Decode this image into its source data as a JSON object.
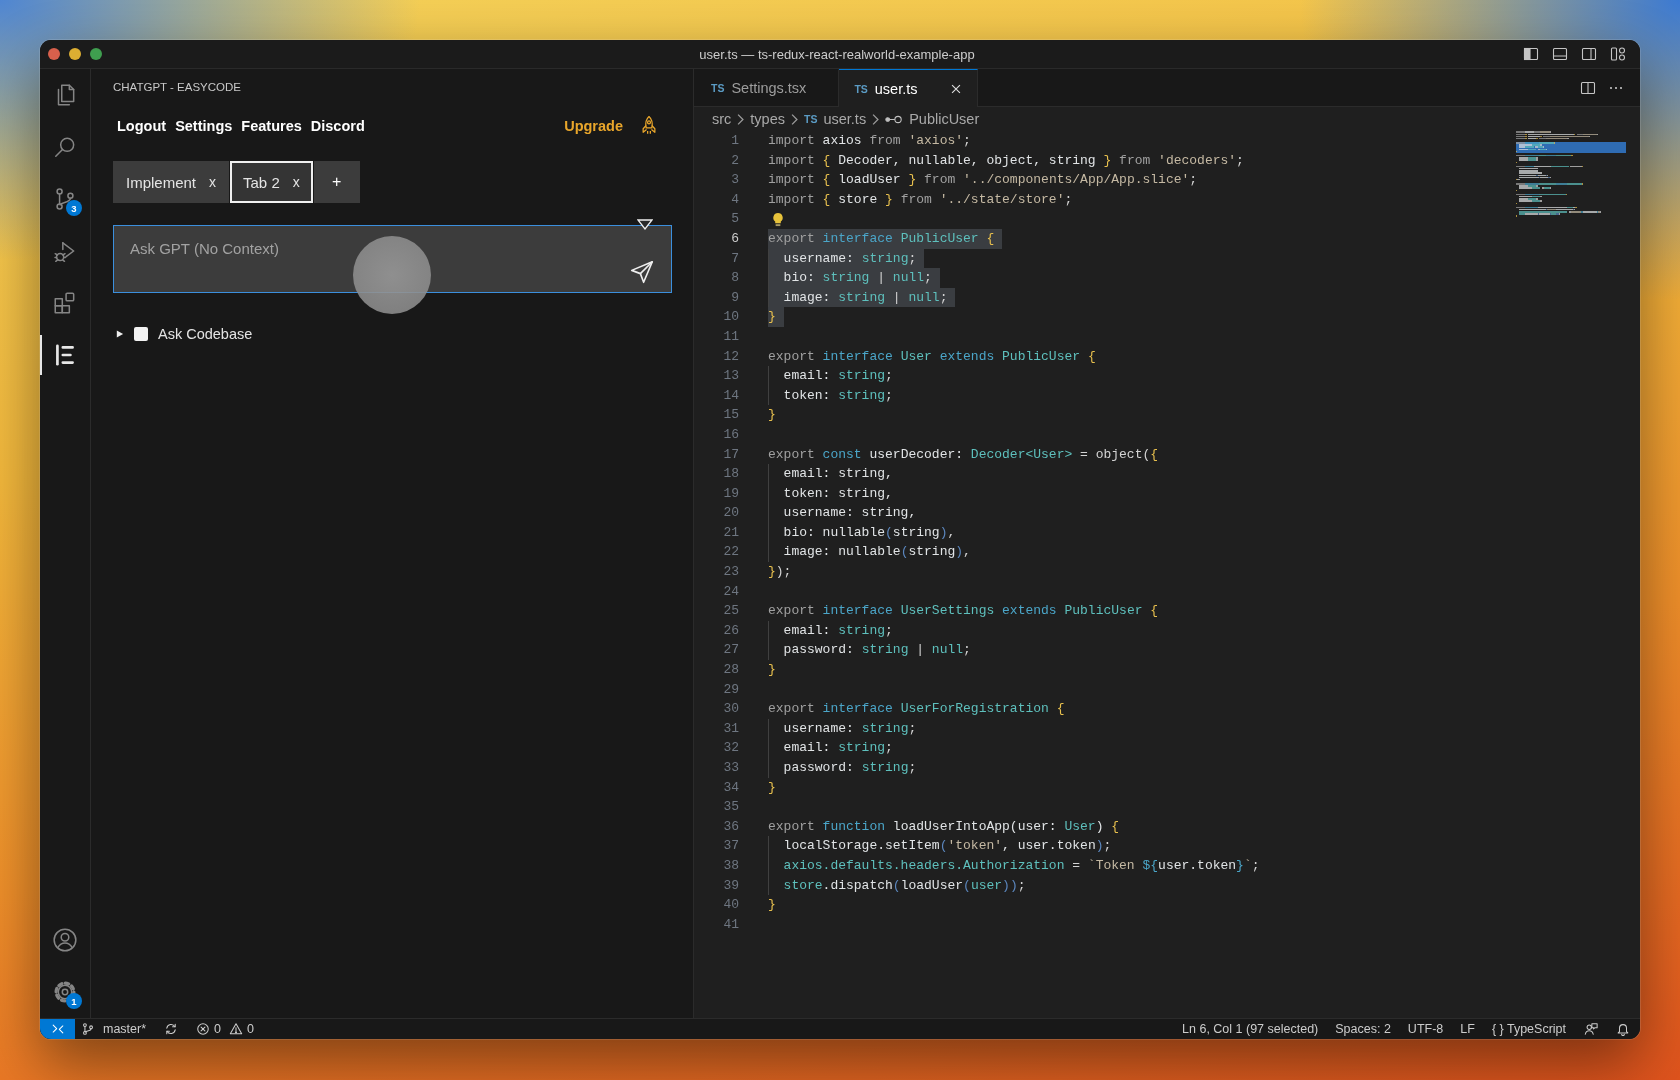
{
  "window": {
    "title": "user.ts — ts-redux-react-realworld-example-app"
  },
  "activity_bar": {
    "items": [
      {
        "selected": false
      },
      {
        "selected": false
      },
      {
        "selected": false,
        "badge": "3"
      },
      {
        "selected": false
      },
      {
        "selected": false
      },
      {
        "selected": true
      }
    ],
    "manage_badge": "1"
  },
  "sidebar": {
    "title": "CHATGPT - EASYCODE",
    "links": [
      "Logout",
      "Settings",
      "Features",
      "Discord"
    ],
    "upgrade": "Upgrade",
    "tabs": [
      {
        "label": "Implement",
        "close": "x",
        "selected": false
      },
      {
        "label": "Tab 2",
        "close": "x",
        "selected": true
      }
    ],
    "new_tab": "+",
    "prompt": {
      "placeholder": "Ask GPT (No Context)"
    },
    "ask_codebase": {
      "label": "Ask Codebase",
      "expanded": false,
      "checked": false
    }
  },
  "editor": {
    "tabs": [
      {
        "file_badge": "TS",
        "label": "Settings.tsx",
        "selected": false
      },
      {
        "file_badge": "TS",
        "label": "user.ts",
        "selected": true
      }
    ],
    "breadcrumbs": [
      {
        "kind": "folder",
        "label": "src"
      },
      {
        "kind": "folder",
        "label": "types"
      },
      {
        "kind": "file",
        "badge": "TS",
        "label": "user.ts"
      },
      {
        "kind": "symbol",
        "label": "PublicUser"
      }
    ],
    "lines": [
      {
        "n": "1",
        "selected": false,
        "current": false,
        "lightbulb": false,
        "tokens": [
          {
            "kind": "keyword",
            "text": "import "
          },
          {
            "kind": "name",
            "text": "axios "
          },
          {
            "kind": "keyword",
            "text": "from "
          },
          {
            "kind": "string",
            "text": "'axios'"
          },
          {
            "kind": "punct",
            "text": ";"
          }
        ]
      },
      {
        "n": "2",
        "selected": false,
        "current": false,
        "lightbulb": false,
        "tokens": [
          {
            "kind": "keyword",
            "text": "import "
          },
          {
            "kind": "brace",
            "text": "{"
          },
          {
            "kind": "name",
            "text": " Decoder, nullable, object, string "
          },
          {
            "kind": "brace",
            "text": "}"
          },
          {
            "kind": "keyword",
            "text": " from "
          },
          {
            "kind": "string",
            "text": "'decoders'"
          },
          {
            "kind": "punct",
            "text": ";"
          }
        ]
      },
      {
        "n": "3",
        "selected": false,
        "current": false,
        "lightbulb": false,
        "tokens": [
          {
            "kind": "keyword",
            "text": "import "
          },
          {
            "kind": "brace",
            "text": "{"
          },
          {
            "kind": "name",
            "text": " loadUser "
          },
          {
            "kind": "brace",
            "text": "}"
          },
          {
            "kind": "keyword",
            "text": " from "
          },
          {
            "kind": "string",
            "text": "'../components/App/App.slice'"
          },
          {
            "kind": "punct",
            "text": ";"
          }
        ]
      },
      {
        "n": "4",
        "selected": false,
        "current": false,
        "lightbulb": false,
        "tokens": [
          {
            "kind": "keyword",
            "text": "import "
          },
          {
            "kind": "brace",
            "text": "{"
          },
          {
            "kind": "name",
            "text": " store "
          },
          {
            "kind": "brace",
            "text": "}"
          },
          {
            "kind": "keyword",
            "text": " from "
          },
          {
            "kind": "string",
            "text": "'../state/store'"
          },
          {
            "kind": "punct",
            "text": ";"
          }
        ]
      },
      {
        "n": "5",
        "selected": false,
        "current": false,
        "lightbulb": true
      },
      {
        "n": "6",
        "selected": true,
        "current": true,
        "lightbulb": false,
        "tokens": [
          {
            "kind": "keyword",
            "text": "export "
          },
          {
            "kind": "storage",
            "text": "interface "
          },
          {
            "kind": "type",
            "text": "PublicUser "
          },
          {
            "kind": "brace",
            "text": "{"
          }
        ]
      },
      {
        "n": "7",
        "selected": true,
        "current": false,
        "lightbulb": false,
        "tokens": [
          {
            "kind": "name",
            "text": "  username: "
          },
          {
            "kind": "type",
            "text": "string"
          },
          {
            "kind": "punct",
            "text": ";"
          }
        ]
      },
      {
        "n": "8",
        "selected": true,
        "current": false,
        "lightbulb": false,
        "tokens": [
          {
            "kind": "name",
            "text": "  bio: "
          },
          {
            "kind": "type",
            "text": "string"
          },
          {
            "kind": "punct",
            "text": " | "
          },
          {
            "kind": "type",
            "text": "null"
          },
          {
            "kind": "punct",
            "text": ";"
          }
        ]
      },
      {
        "n": "9",
        "selected": true,
        "current": false,
        "lightbulb": false,
        "tokens": [
          {
            "kind": "name",
            "text": "  image: "
          },
          {
            "kind": "type",
            "text": "string"
          },
          {
            "kind": "punct",
            "text": " | "
          },
          {
            "kind": "type",
            "text": "null"
          },
          {
            "kind": "punct",
            "text": ";"
          }
        ]
      },
      {
        "n": "10",
        "selected": true,
        "current": false,
        "lightbulb": false,
        "tokens": [
          {
            "kind": "brace",
            "text": "}"
          }
        ]
      },
      {
        "n": "11",
        "selected": false,
        "current": false,
        "lightbulb": false
      },
      {
        "n": "12",
        "selected": false,
        "current": false,
        "lightbulb": false,
        "tokens": [
          {
            "kind": "keyword",
            "text": "export "
          },
          {
            "kind": "storage",
            "text": "interface "
          },
          {
            "kind": "type",
            "text": "User "
          },
          {
            "kind": "storage",
            "text": "extends "
          },
          {
            "kind": "type",
            "text": "PublicUser "
          },
          {
            "kind": "brace",
            "text": "{"
          }
        ]
      },
      {
        "n": "13",
        "selected": false,
        "current": false,
        "lightbulb": false,
        "tokens": [
          {
            "kind": "name",
            "text": "  email: "
          },
          {
            "kind": "type",
            "text": "string"
          },
          {
            "kind": "punct",
            "text": ";"
          }
        ]
      },
      {
        "n": "14",
        "selected": false,
        "current": false,
        "lightbulb": false,
        "tokens": [
          {
            "kind": "name",
            "text": "  token: "
          },
          {
            "kind": "type",
            "text": "string"
          },
          {
            "kind": "punct",
            "text": ";"
          }
        ]
      },
      {
        "n": "15",
        "selected": false,
        "current": false,
        "lightbulb": false,
        "tokens": [
          {
            "kind": "brace",
            "text": "}"
          }
        ]
      },
      {
        "n": "16",
        "selected": false,
        "current": false,
        "lightbulb": false
      },
      {
        "n": "17",
        "selected": false,
        "current": false,
        "lightbulb": false,
        "tokens": [
          {
            "kind": "keyword",
            "text": "export "
          },
          {
            "kind": "storage",
            "text": "const "
          },
          {
            "kind": "name",
            "text": "userDecoder: "
          },
          {
            "kind": "type",
            "text": "Decoder<User>"
          },
          {
            "kind": "punct",
            "text": " = object("
          },
          {
            "kind": "brace",
            "text": "{"
          }
        ]
      },
      {
        "n": "18",
        "selected": false,
        "current": false,
        "lightbulb": false,
        "tokens": [
          {
            "kind": "name",
            "text": "  email: string,"
          }
        ]
      },
      {
        "n": "19",
        "selected": false,
        "current": false,
        "lightbulb": false,
        "tokens": [
          {
            "kind": "name",
            "text": "  token: string,"
          }
        ]
      },
      {
        "n": "20",
        "selected": false,
        "current": false,
        "lightbulb": false,
        "tokens": [
          {
            "kind": "name",
            "text": "  username: string,"
          }
        ]
      },
      {
        "n": "21",
        "selected": false,
        "current": false,
        "lightbulb": false,
        "tokens": [
          {
            "kind": "name",
            "text": "  bio: nullable"
          },
          {
            "kind": "paren",
            "text": "("
          },
          {
            "kind": "name",
            "text": "string"
          },
          {
            "kind": "paren",
            "text": ")"
          },
          {
            "kind": "punct",
            "text": ","
          }
        ]
      },
      {
        "n": "22",
        "selected": false,
        "current": false,
        "lightbulb": false,
        "tokens": [
          {
            "kind": "name",
            "text": "  image: nullable"
          },
          {
            "kind": "paren",
            "text": "("
          },
          {
            "kind": "name",
            "text": "string"
          },
          {
            "kind": "paren",
            "text": ")"
          },
          {
            "kind": "punct",
            "text": ","
          }
        ]
      },
      {
        "n": "23",
        "selected": false,
        "current": false,
        "lightbulb": false,
        "tokens": [
          {
            "kind": "brace",
            "text": "}"
          },
          {
            "kind": "punct",
            "text": ");"
          }
        ]
      },
      {
        "n": "24",
        "selected": false,
        "current": false,
        "lightbulb": false
      },
      {
        "n": "25",
        "selected": false,
        "current": false,
        "lightbulb": false,
        "tokens": [
          {
            "kind": "keyword",
            "text": "export "
          },
          {
            "kind": "storage",
            "text": "interface "
          },
          {
            "kind": "type",
            "text": "UserSettings "
          },
          {
            "kind": "storage",
            "text": "extends "
          },
          {
            "kind": "type",
            "text": "PublicUser "
          },
          {
            "kind": "brace",
            "text": "{"
          }
        ]
      },
      {
        "n": "26",
        "selected": false,
        "current": false,
        "lightbulb": false,
        "tokens": [
          {
            "kind": "name",
            "text": "  email: "
          },
          {
            "kind": "type",
            "text": "string"
          },
          {
            "kind": "punct",
            "text": ";"
          }
        ]
      },
      {
        "n": "27",
        "selected": false,
        "current": false,
        "lightbulb": false,
        "tokens": [
          {
            "kind": "name",
            "text": "  password: "
          },
          {
            "kind": "type",
            "text": "string"
          },
          {
            "kind": "punct",
            "text": " | "
          },
          {
            "kind": "type",
            "text": "null"
          },
          {
            "kind": "punct",
            "text": ";"
          }
        ]
      },
      {
        "n": "28",
        "selected": false,
        "current": false,
        "lightbulb": false,
        "tokens": [
          {
            "kind": "brace",
            "text": "}"
          }
        ]
      },
      {
        "n": "29",
        "selected": false,
        "current": false,
        "lightbulb": false
      },
      {
        "n": "30",
        "selected": false,
        "current": false,
        "lightbulb": false,
        "tokens": [
          {
            "kind": "keyword",
            "text": "export "
          },
          {
            "kind": "storage",
            "text": "interface "
          },
          {
            "kind": "type",
            "text": "UserForRegistration "
          },
          {
            "kind": "brace",
            "text": "{"
          }
        ]
      },
      {
        "n": "31",
        "selected": false,
        "current": false,
        "lightbulb": false,
        "tokens": [
          {
            "kind": "name",
            "text": "  username: "
          },
          {
            "kind": "type",
            "text": "string"
          },
          {
            "kind": "punct",
            "text": ";"
          }
        ]
      },
      {
        "n": "32",
        "selected": false,
        "current": false,
        "lightbulb": false,
        "tokens": [
          {
            "kind": "name",
            "text": "  email: "
          },
          {
            "kind": "type",
            "text": "string"
          },
          {
            "kind": "punct",
            "text": ";"
          }
        ]
      },
      {
        "n": "33",
        "selected": false,
        "current": false,
        "lightbulb": false,
        "tokens": [
          {
            "kind": "name",
            "text": "  password: "
          },
          {
            "kind": "type",
            "text": "string"
          },
          {
            "kind": "punct",
            "text": ";"
          }
        ]
      },
      {
        "n": "34",
        "selected": false,
        "current": false,
        "lightbulb": false,
        "tokens": [
          {
            "kind": "brace",
            "text": "}"
          }
        ]
      },
      {
        "n": "35",
        "selected": false,
        "current": false,
        "lightbulb": false
      },
      {
        "n": "36",
        "selected": false,
        "current": false,
        "lightbulb": false,
        "tokens": [
          {
            "kind": "keyword",
            "text": "export "
          },
          {
            "kind": "storage",
            "text": "function "
          },
          {
            "kind": "name",
            "text": "loadUserIntoApp(user: "
          },
          {
            "kind": "type",
            "text": "User"
          },
          {
            "kind": "name",
            "text": ") "
          },
          {
            "kind": "brace",
            "text": "{"
          }
        ]
      },
      {
        "n": "37",
        "selected": false,
        "current": false,
        "lightbulb": false,
        "tokens": [
          {
            "kind": "name",
            "text": "  localStorage.setItem"
          },
          {
            "kind": "paren",
            "text": "("
          },
          {
            "kind": "string",
            "text": "'token'"
          },
          {
            "kind": "name",
            "text": ", user.token"
          },
          {
            "kind": "paren",
            "text": ")"
          },
          {
            "kind": "punct",
            "text": ";"
          }
        ]
      },
      {
        "n": "38",
        "selected": false,
        "current": false,
        "lightbulb": false,
        "tokens": [
          {
            "kind": "type",
            "text": "  axios.defaults.headers.Authorization"
          },
          {
            "kind": "punct",
            "text": " = "
          },
          {
            "kind": "string",
            "text": "`Token "
          },
          {
            "kind": "storage",
            "text": "${"
          },
          {
            "kind": "name",
            "text": "user.token"
          },
          {
            "kind": "storage",
            "text": "}"
          },
          {
            "kind": "string",
            "text": "`"
          },
          {
            "kind": "punct",
            "text": ";"
          }
        ]
      },
      {
        "n": "39",
        "selected": false,
        "current": false,
        "lightbulb": false,
        "tokens": [
          {
            "kind": "type",
            "text": "  store"
          },
          {
            "kind": "name",
            "text": ".dispatch"
          },
          {
            "kind": "paren",
            "text": "("
          },
          {
            "kind": "name",
            "text": "loadUser"
          },
          {
            "kind": "paren",
            "text": "("
          },
          {
            "kind": "type",
            "text": "user"
          },
          {
            "kind": "paren",
            "text": "))"
          },
          {
            "kind": "punct",
            "text": ";"
          }
        ]
      },
      {
        "n": "40",
        "selected": false,
        "current": false,
        "lightbulb": false,
        "tokens": [
          {
            "kind": "brace",
            "text": "}"
          }
        ]
      },
      {
        "n": "41",
        "selected": false,
        "current": false,
        "lightbulb": false
      }
    ]
  },
  "status_bar": {
    "branch": "master*",
    "errors": "0",
    "warnings": "0",
    "cursor": "Ln 6, Col 1 (97 selected)",
    "indentation": "Spaces: 2",
    "encoding": "UTF-8",
    "line_ending": "LF",
    "language_icon": "{ }",
    "language": "TypeScript"
  }
}
